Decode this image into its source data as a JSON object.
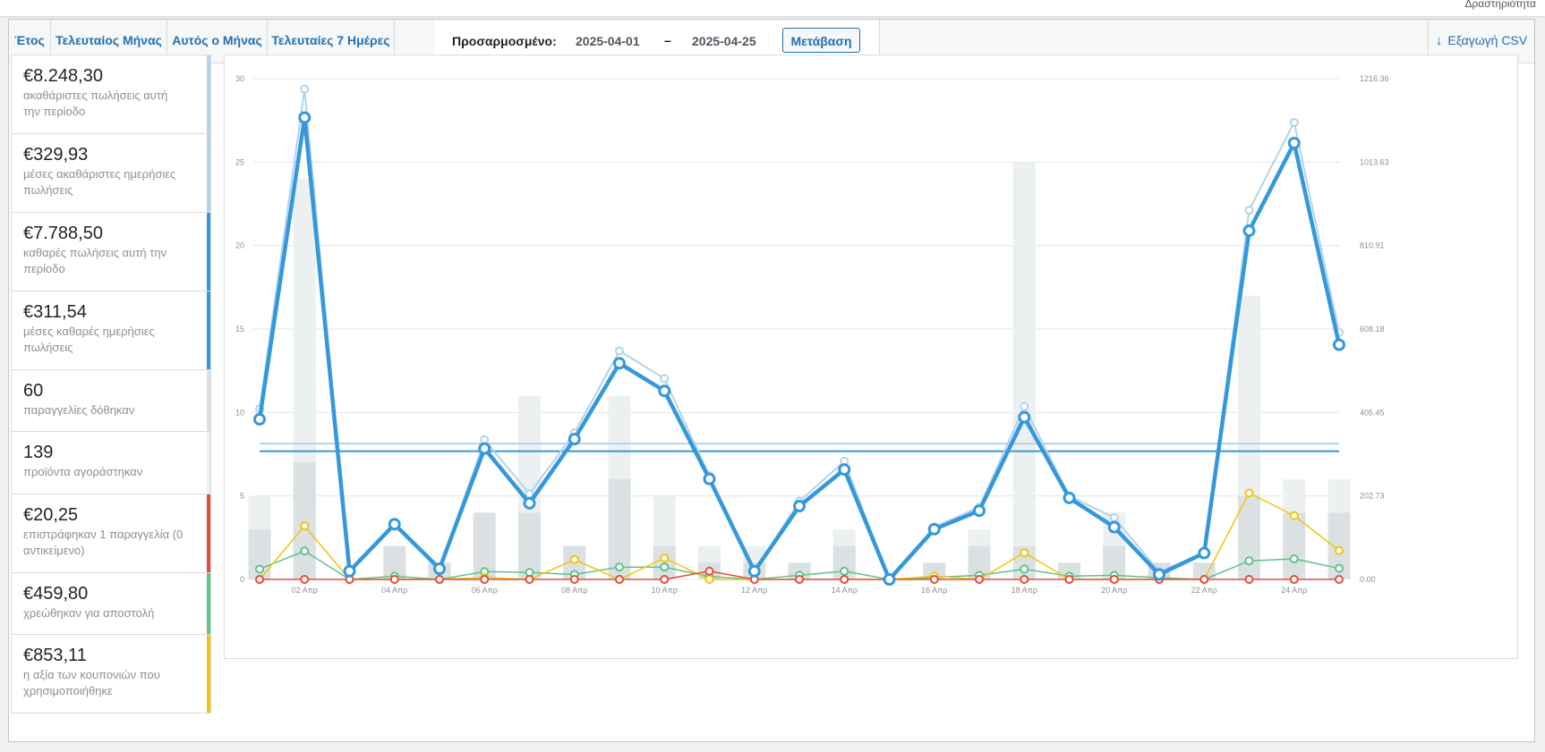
{
  "topbar": {
    "activity": "Δραστηριότητα"
  },
  "tabs": {
    "year": "Έτος",
    "last_month": "Τελευταίος Μήνας",
    "this_month": "Αυτός ο Μήνας",
    "last7": "Τελευταίες 7 Ημέρες"
  },
  "custom": {
    "label": "Προσαρμοσμένο:",
    "from": "2025-04-01",
    "dash": "–",
    "to": "2025-04-25",
    "go": "Μετάβαση"
  },
  "export": {
    "label": "Εξαγωγή CSV"
  },
  "legend": [
    {
      "amount": "€8.248,30",
      "desc": "ακαθάριστες πωλήσεις αυτή την περίοδο",
      "color": "#b1d4ea"
    },
    {
      "amount": "€329,93",
      "desc": "μέσες ακαθάριστες ημερήσιες πωλήσεις",
      "color": "#b1d4ea"
    },
    {
      "amount": "€7.788,50",
      "desc": "καθαρές πωλήσεις αυτή την περίοδο",
      "color": "#3498db"
    },
    {
      "amount": "€311,54",
      "desc": "μέσες καθαρές ημερήσιες πωλήσεις",
      "color": "#3498db"
    },
    {
      "amount": "60",
      "desc": "παραγγελίες δόθηκαν",
      "color": "#dbe1e3"
    },
    {
      "amount": "139",
      "desc": "προϊόντα αγοράστηκαν",
      "color": "#ecf0f1"
    },
    {
      "amount": "€20,25",
      "desc": "επιστράφηκαν 1 παραγγελία (0 αντικείμενο)",
      "color": "#e74c3c"
    },
    {
      "amount": "€459,80",
      "desc": "χρεώθηκαν για αποστολή",
      "color": "#5cc488"
    },
    {
      "amount": "€853,11",
      "desc": "η αξία των κουπονιών που χρησιμοποιήθηκε",
      "color": "#f1c40f"
    }
  ],
  "colors": {
    "gross": "#b1d4ea",
    "net": "#3498db",
    "orders": "#dbe1e3",
    "items": "#ecf0f1",
    "refunds": "#e74c3c",
    "shipping": "#5cc488",
    "coupons": "#f1c40f",
    "grid": "#e2e4e7",
    "tick": "#8c8f94"
  },
  "chart_data": {
    "type": "bar",
    "x": [
      "01",
      "02",
      "03",
      "04",
      "05",
      "06",
      "07",
      "08",
      "09",
      "10",
      "11",
      "12",
      "13",
      "14",
      "15",
      "16",
      "17",
      "18",
      "19",
      "20",
      "21",
      "22",
      "23",
      "24",
      "25"
    ],
    "x_tick_labels": [
      "02 Απρ",
      "04 Απρ",
      "06 Απρ",
      "08 Απρ",
      "10 Απρ",
      "12 Απρ",
      "14 Απρ",
      "16 Απρ",
      "18 Απρ",
      "20 Απρ",
      "22 Απρ",
      "24 Απρ"
    ],
    "y_left_ticks": [
      "0",
      "5",
      "10",
      "15",
      "20",
      "25",
      "30"
    ],
    "y_right_ticks": [
      "0.00",
      "202.73",
      "405.45",
      "608.18",
      "810.91",
      "1013.63",
      "1216.36"
    ],
    "ylim_left": [
      0,
      30
    ],
    "ylim_right": [
      0,
      1216.36
    ],
    "series": [
      {
        "key": "items",
        "type": "bar",
        "axis": "left",
        "values": [
          5,
          24,
          0,
          0,
          0,
          0,
          11,
          0,
          11,
          5,
          2,
          2,
          1,
          3,
          0,
          1,
          3,
          25,
          1,
          4,
          1,
          1,
          17,
          6,
          6
        ]
      },
      {
        "key": "orders",
        "type": "bar",
        "axis": "left",
        "values": [
          3,
          7,
          0,
          2,
          1,
          4,
          4,
          2,
          6,
          2,
          1,
          1,
          1,
          2,
          0,
          1,
          2,
          2,
          1,
          2,
          1,
          1,
          5,
          4,
          4
        ]
      },
      {
        "key": "gross",
        "type": "line",
        "axis": "right",
        "values": [
          414,
          1191,
          20,
          138,
          26,
          339,
          208,
          356,
          555,
          488,
          252,
          20,
          190,
          287,
          0,
          127,
          176,
          420,
          203,
          150,
          19,
          64,
          897,
          1110,
          600
        ]
      },
      {
        "key": "net",
        "type": "line",
        "axis": "right",
        "values": [
          389,
          1122,
          20,
          134,
          26,
          318,
          185,
          341,
          525,
          458,
          244,
          20,
          178,
          267,
          0,
          122,
          167,
          394,
          198,
          127,
          12,
          64,
          847,
          1060,
          570
        ]
      },
      {
        "key": "shipping",
        "type": "line",
        "axis": "right",
        "values": [
          25,
          69,
          0,
          8,
          0,
          19,
          17,
          12,
          30,
          30,
          7,
          0,
          10,
          20,
          0,
          5,
          10,
          25,
          8,
          10,
          4,
          0,
          45,
          50,
          27
        ]
      },
      {
        "key": "coupons",
        "type": "line",
        "axis": "right",
        "values": [
          0,
          130,
          0,
          0,
          0,
          5,
          0,
          48,
          0,
          52,
          0,
          0,
          0,
          0,
          0,
          8,
          0,
          65,
          0,
          0,
          0,
          0,
          210,
          155,
          70
        ]
      },
      {
        "key": "refunds",
        "type": "line",
        "axis": "right",
        "values": [
          0,
          0,
          0,
          0,
          0,
          0,
          0,
          0,
          0,
          0,
          20,
          0,
          0,
          0,
          0,
          0,
          0,
          0,
          0,
          0,
          0,
          0,
          0,
          0,
          0
        ]
      }
    ],
    "avg_lines": [
      {
        "key": "gross",
        "value": 329.93
      },
      {
        "key": "net",
        "value": 311.54
      }
    ]
  }
}
